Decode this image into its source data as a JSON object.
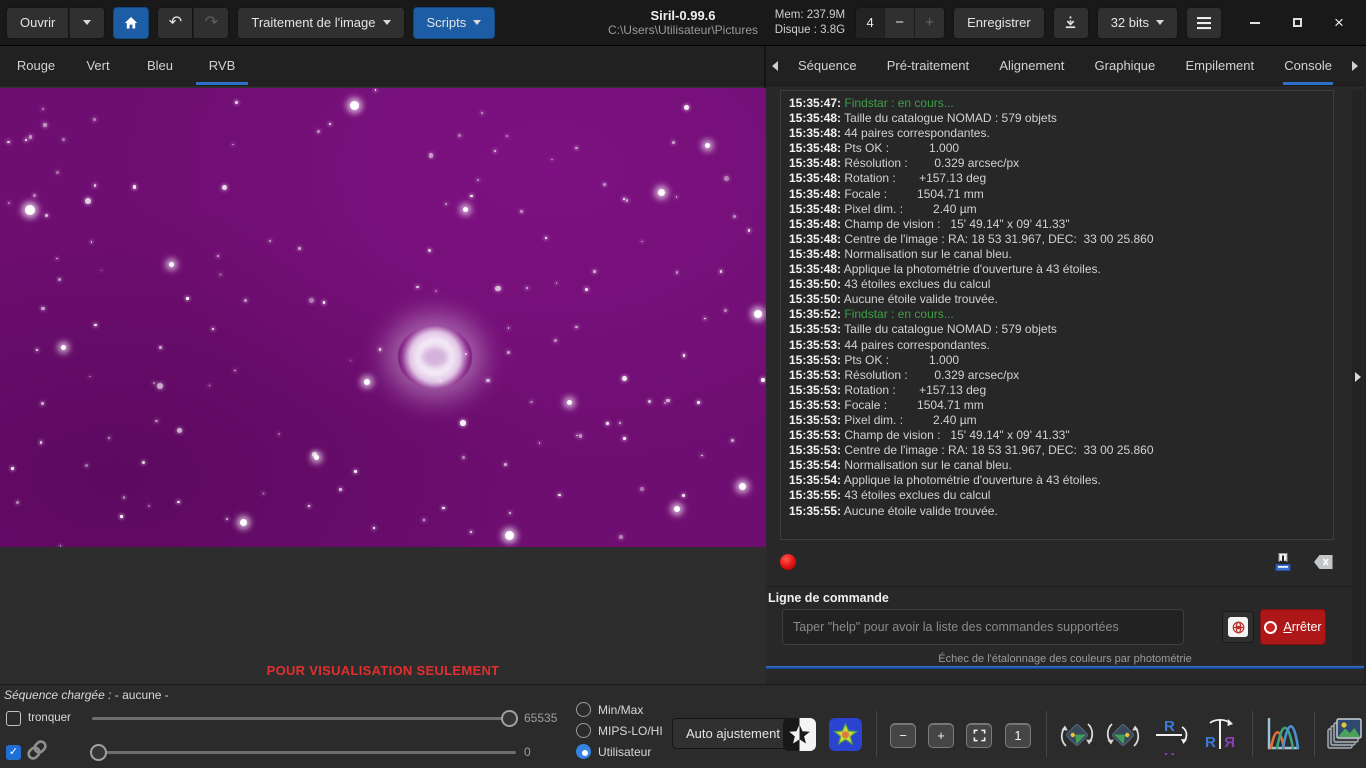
{
  "window": {
    "title": "Siril-0.99.6",
    "path": "C:\\Users\\Utilisateur\\Pictures"
  },
  "header": {
    "open": "Ouvrir",
    "image_processing": "Traitement de l'image",
    "scripts": "Scripts",
    "mem": "Mem: 237.9M",
    "disk": "Disque : 3.8G",
    "threads": "4",
    "save": "Enregistrer",
    "bit_depth": "32 bits"
  },
  "icons": {
    "undo": "↶",
    "redo": "↷",
    "minus": "−",
    "plus": "+",
    "close": "×",
    "check": "✓",
    "zoom_one": "1",
    "flip_letter": "R"
  },
  "left_tabs": {
    "items": [
      "Rouge",
      "Vert",
      "Bleu",
      "RVB"
    ],
    "active": "RVB"
  },
  "right_tabs": {
    "items": [
      "Séquence",
      "Pré-traitement",
      "Alignement",
      "Graphique",
      "Empilement",
      "Console"
    ],
    "active": "Console"
  },
  "image_overlay": {
    "warning": "POUR VISUALISATION SEULEMENT"
  },
  "console": {
    "lines": [
      {
        "time": "15:35:47:",
        "text": "Findstar : en cours...",
        "level": "progress"
      },
      {
        "time": "15:35:48:",
        "text": "Taille du catalogue NOMAD : 579 objets"
      },
      {
        "time": "15:35:48:",
        "text": "44 paires correspondantes."
      },
      {
        "time": "15:35:48:",
        "text": "Pts OK :            1.000"
      },
      {
        "time": "15:35:48:",
        "text": "Résolution :        0.329 arcsec/px"
      },
      {
        "time": "15:35:48:",
        "text": "Rotation :       +157.13 deg"
      },
      {
        "time": "15:35:48:",
        "text": "Focale :         1504.71 mm"
      },
      {
        "time": "15:35:48:",
        "text": "Pixel dim. :         2.40 µm"
      },
      {
        "time": "15:35:48:",
        "text": "Champ de vision :   15' 49.14\" x 09' 41.33\""
      },
      {
        "time": "15:35:48:",
        "text": "Centre de l'image : RA: 18 53 31.967, DEC:  33 00 25.860"
      },
      {
        "time": "15:35:48:",
        "text": "Normalisation sur le canal bleu."
      },
      {
        "time": "15:35:48:",
        "text": "Applique la photométrie d'ouverture à 43 étoiles."
      },
      {
        "time": "15:35:50:",
        "text": "43 étoiles exclues du calcul"
      },
      {
        "time": "15:35:50:",
        "text": "Aucune étoile valide trouvée."
      },
      {
        "time": "15:35:52:",
        "text": "Findstar : en cours...",
        "level": "progress"
      },
      {
        "time": "15:35:53:",
        "text": "Taille du catalogue NOMAD : 579 objets"
      },
      {
        "time": "15:35:53:",
        "text": "44 paires correspondantes."
      },
      {
        "time": "15:35:53:",
        "text": "Pts OK :            1.000"
      },
      {
        "time": "15:35:53:",
        "text": "Résolution :        0.329 arcsec/px"
      },
      {
        "time": "15:35:53:",
        "text": "Rotation :       +157.13 deg"
      },
      {
        "time": "15:35:53:",
        "text": "Focale :         1504.71 mm"
      },
      {
        "time": "15:35:53:",
        "text": "Pixel dim. :         2.40 µm"
      },
      {
        "time": "15:35:53:",
        "text": "Champ de vision :   15' 49.14\" x 09' 41.33\""
      },
      {
        "time": "15:35:53:",
        "text": "Centre de l'image : RA: 18 53 31.967, DEC:  33 00 25.860"
      },
      {
        "time": "15:35:54:",
        "text": "Normalisation sur le canal bleu."
      },
      {
        "time": "15:35:54:",
        "text": "Applique la photométrie d'ouverture à 43 étoiles."
      },
      {
        "time": "15:35:55:",
        "text": "43 étoiles exclues du calcul"
      },
      {
        "time": "15:35:55:",
        "text": "Aucune étoile valide trouvée."
      }
    ]
  },
  "command_line": {
    "label": "Ligne de commande",
    "placeholder": "Taper \"help\" pour avoir la liste des commandes supportées",
    "stop": "Arrêter"
  },
  "status_bar": {
    "message": "Échec de l'étalonnage des couleurs par photométrie"
  },
  "bottom_bar": {
    "sequence_label": "Séquence chargée :",
    "sequence_value": "- aucune -",
    "truncate": "tronquer",
    "high_value": "65535",
    "low_value": "0",
    "modes": [
      "Min/Max",
      "MIPS-LO/HI",
      "Utilisateur"
    ],
    "mode_selected": "Utilisateur",
    "auto_adjust": "Auto ajustement"
  },
  "colors": {
    "accent_blue": "#1d5da6",
    "tab_underline": "#2e6fc8",
    "console_green": "#3f9e46",
    "stop_red": "#ad1717",
    "record_red": "#e01010",
    "warning_red": "#e12f2f",
    "image_purple": "#6f0e72"
  }
}
